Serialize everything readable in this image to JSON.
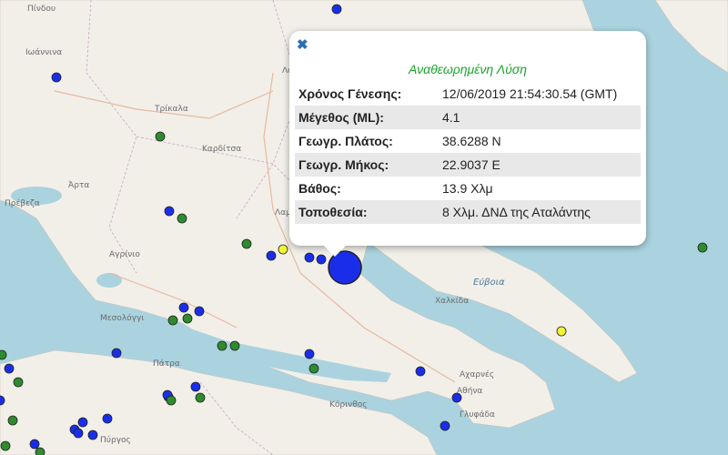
{
  "map": {
    "land_color": "#f2efe9",
    "sea_color": "#aad3df",
    "places": [
      {
        "id": "pindos",
        "label": "Πίνδου"
      },
      {
        "id": "ioannina",
        "label": "Ιωάννινα"
      },
      {
        "id": "larisa",
        "label": "Λάρισα"
      },
      {
        "id": "trikala",
        "label": "Τρίκαλα"
      },
      {
        "id": "karditsa",
        "label": "Καρδίτσα"
      },
      {
        "id": "arta",
        "label": "Άρτα"
      },
      {
        "id": "preveza",
        "label": "Πρέβεζα"
      },
      {
        "id": "lamia",
        "label": "Λαμία"
      },
      {
        "id": "agrinio",
        "label": "Αγρίνιο"
      },
      {
        "id": "mesolongi",
        "label": "Μεσολόγγι"
      },
      {
        "id": "patra",
        "label": "Πάτρα"
      },
      {
        "id": "korinthos",
        "label": "Κόρινθος"
      },
      {
        "id": "chalkida",
        "label": "Χαλκίδα"
      },
      {
        "id": "evia",
        "label": "Εύβοια"
      },
      {
        "id": "acharnes",
        "label": "Αχαρνές"
      },
      {
        "id": "athina",
        "label": "Αθήνα"
      },
      {
        "id": "glyfada",
        "label": "Γλυφάδα"
      },
      {
        "id": "pyrgos",
        "label": "Πύργος"
      }
    ],
    "marker_colors": {
      "blue": "#1a2eea",
      "green": "#2e8b2e",
      "yellow": "#f2f23a",
      "stroke": "#222222"
    }
  },
  "popup": {
    "close_icon": "close-icon",
    "close_symbol": "✖",
    "title": "Αναθεωρημένη Λύση",
    "title_color": "#1aa52c",
    "rows": [
      {
        "label": "Χρόνος Γένεσης:",
        "value": "12/06/2019 21:54:30.54 (GMT)"
      },
      {
        "label": "Μέγεθος (ML):",
        "value": "4.1"
      },
      {
        "label": "Γεωγρ. Πλάτος:",
        "value": "38.6288 N"
      },
      {
        "label": "Γεωγρ. Μήκος:",
        "value": "22.9037 E"
      },
      {
        "label": "Βάθος:",
        "value": "13.9 Χλμ"
      },
      {
        "label": "Τοποθεσία:",
        "value": "8 Χλμ. ΔΝΔ της Αταλάντης"
      }
    ]
  }
}
